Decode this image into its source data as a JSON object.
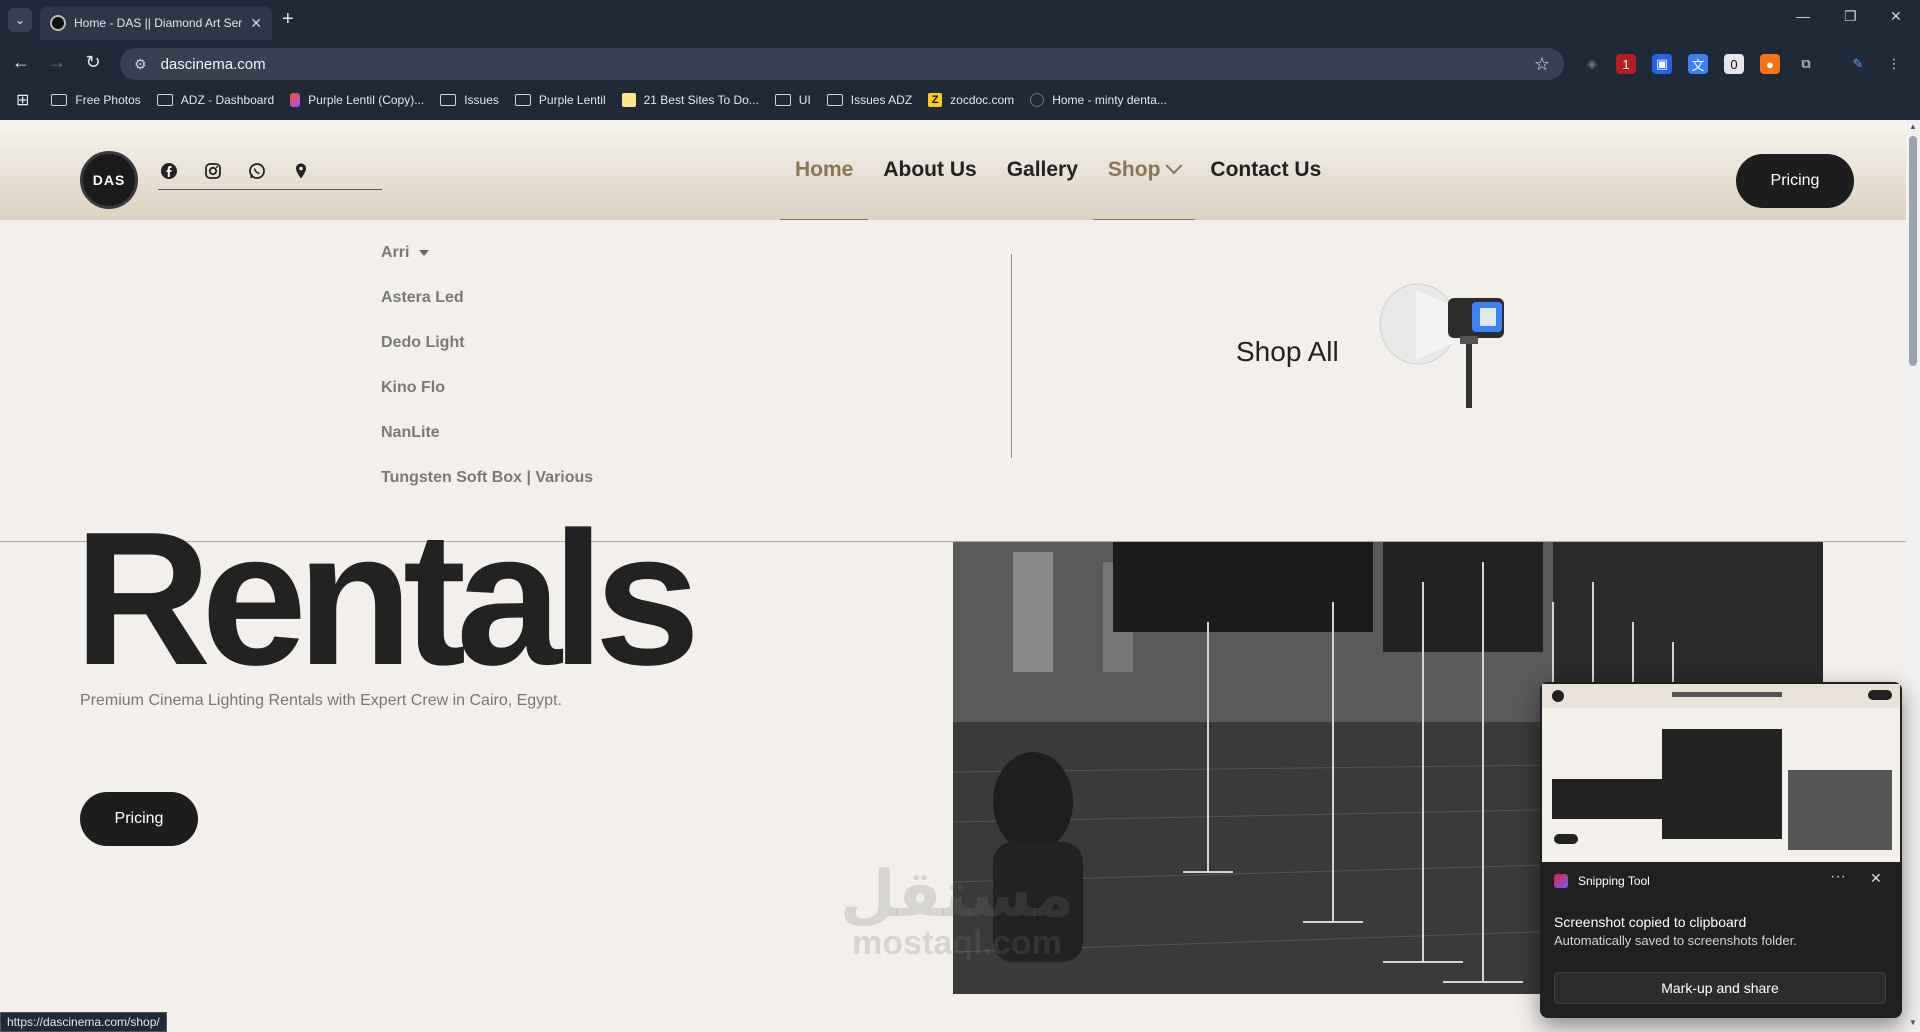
{
  "browser": {
    "tab_title": "Home - DAS || Diamond Art Ser",
    "url": "dascinema.com",
    "status_url": "https://dascinema.com/shop/",
    "bookmarks": [
      {
        "label": "Free Photos",
        "icon": "folder-icon"
      },
      {
        "label": "ADZ - Dashboard",
        "icon": "folder-icon"
      },
      {
        "label": "Purple Lentil (Copy)...",
        "icon": "figma-icon"
      },
      {
        "label": "Issues",
        "icon": "folder-icon"
      },
      {
        "label": "Purple Lentil",
        "icon": "folder-icon"
      },
      {
        "label": "21 Best Sites To Do...",
        "icon": "image-icon"
      },
      {
        "label": "UI",
        "icon": "folder-icon"
      },
      {
        "label": "Issues ADZ",
        "icon": "folder-icon"
      },
      {
        "label": "zocdoc.com",
        "icon": "zocdoc-icon"
      },
      {
        "label": "Home - minty denta...",
        "icon": "globe-icon"
      }
    ],
    "extension_badges": {
      "ext1": "1",
      "ext2": "0"
    }
  },
  "site": {
    "logo_text": "DAS",
    "nav": {
      "home": "Home",
      "about": "About Us",
      "gallery": "Gallery",
      "shop": "Shop",
      "contact": "Contact Us"
    },
    "pricing_label": "Pricing",
    "shop_menu": {
      "categories": [
        "Arri",
        "Astera Led",
        "Dedo Light",
        "Kino Flo",
        "NanLite",
        "Tungsten Soft Box | Various"
      ],
      "shop_all": "Shop All"
    },
    "hero": {
      "title": "Rentals",
      "subtitle": "Premium Cinema Lighting Rentals with Expert Crew in Cairo, Egypt.",
      "button": "Pricing"
    },
    "watermark": {
      "arabic": "مستقل",
      "latin": "mostaql.com"
    }
  },
  "toast": {
    "app": "Snipping Tool",
    "title": "Screenshot copied to clipboard",
    "body": "Automatically saved to screenshots folder.",
    "button": "Mark-up and share",
    "more": "···",
    "close": "✕"
  },
  "colors": {
    "accent": "#8b7553",
    "dark": "#1d1d1d",
    "page_bg": "#f3f0ec",
    "browser_bg": "#1f2937"
  }
}
